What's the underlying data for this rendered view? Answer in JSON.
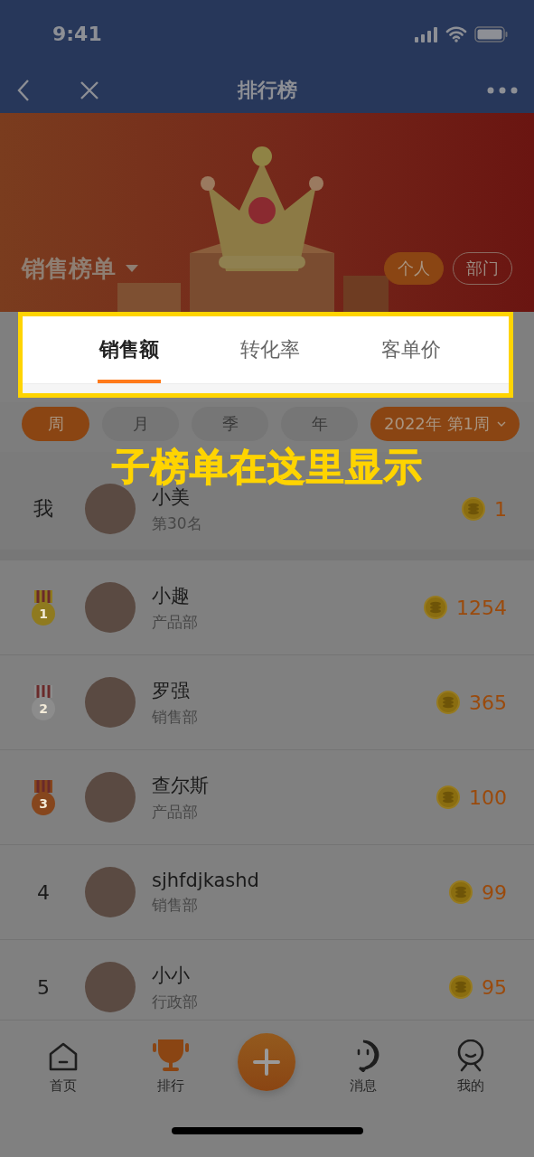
{
  "status_bar": {
    "time": "9:41"
  },
  "nav": {
    "title": "排行榜"
  },
  "banner": {
    "title": "销售榜单",
    "scopes": [
      {
        "label": "个人",
        "selected": true
      },
      {
        "label": "部门",
        "selected": false
      }
    ]
  },
  "tabs": [
    {
      "label": "销售额",
      "selected": true
    },
    {
      "label": "转化率",
      "selected": false
    },
    {
      "label": "客单价",
      "selected": false
    }
  ],
  "periods": [
    {
      "label": "周",
      "selected": true
    },
    {
      "label": "月",
      "selected": false
    },
    {
      "label": "季",
      "selected": false
    },
    {
      "label": "年",
      "selected": false
    }
  ],
  "date_picker": {
    "label": "2022年 第1周"
  },
  "annotation": {
    "text": "子榜单在这里显示"
  },
  "me": {
    "rank": "我",
    "name": "小美",
    "subtitle": "第30名",
    "score": "1"
  },
  "rows": [
    {
      "kind": "medal",
      "rank": "1",
      "color": "#8f7a1f",
      "name": "小趣",
      "department": "产品部",
      "score": "1254"
    },
    {
      "kind": "medal",
      "rank": "2",
      "color": "#8c8c8c",
      "name": "罗强",
      "department": "销售部",
      "score": "365"
    },
    {
      "kind": "medal",
      "rank": "3",
      "color": "#86461d",
      "name": "查尔斯",
      "department": "产品部",
      "score": "100"
    },
    {
      "kind": "number",
      "rank": "4",
      "name": "sjhfdjkashd",
      "department": "销售部",
      "score": "99"
    },
    {
      "kind": "number",
      "rank": "5",
      "name": "小小",
      "department": "行政部",
      "score": "95"
    }
  ],
  "bottom_nav": [
    {
      "label": "首页",
      "selected": false
    },
    {
      "label": "排行",
      "selected": true
    },
    {
      "label": "消息",
      "selected": false
    },
    {
      "label": "我的",
      "selected": false
    }
  ]
}
